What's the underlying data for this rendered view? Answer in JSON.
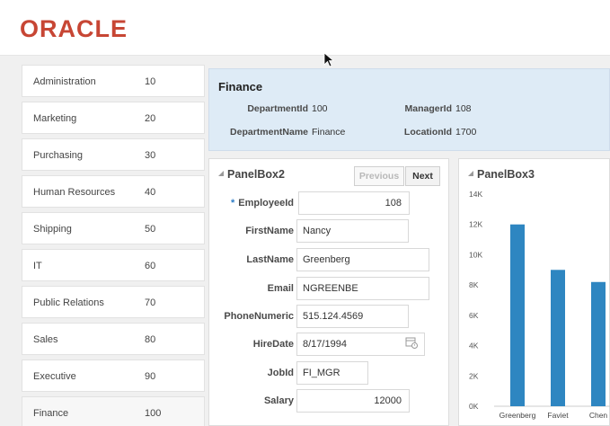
{
  "header": {
    "logo_text": "ORACLE",
    "brand_color": "#c74634"
  },
  "departments": [
    {
      "name": "Administration",
      "id": "10"
    },
    {
      "name": "Marketing",
      "id": "20"
    },
    {
      "name": "Purchasing",
      "id": "30"
    },
    {
      "name": "Human Resources",
      "id": "40"
    },
    {
      "name": "Shipping",
      "id": "50"
    },
    {
      "name": "IT",
      "id": "60"
    },
    {
      "name": "Public Relations",
      "id": "70"
    },
    {
      "name": "Sales",
      "id": "80"
    },
    {
      "name": "Executive",
      "id": "90"
    },
    {
      "name": "Finance",
      "id": "100"
    }
  ],
  "selected_department": "Finance",
  "finance_detail": {
    "title": "Finance",
    "department_id_label": "DepartmentId",
    "department_id": "100",
    "manager_id_label": "ManagerId",
    "manager_id": "108",
    "department_name_label": "DepartmentName",
    "department_name": "Finance",
    "location_id_label": "LocationId",
    "location_id": "1700"
  },
  "panel2": {
    "title": "PanelBox2",
    "previous_label": "Previous",
    "next_label": "Next",
    "fields": {
      "employee_id": {
        "label": "EmployeeId",
        "value": "108",
        "required": "*"
      },
      "first_name": {
        "label": "FirstName",
        "value": "Nancy"
      },
      "last_name": {
        "label": "LastName",
        "value": "Greenberg"
      },
      "email": {
        "label": "Email",
        "value": "NGREENBE"
      },
      "phone": {
        "label": "PhoneNumeric",
        "value": "515.124.4569"
      },
      "hire_date": {
        "label": "HireDate",
        "value": "8/17/1994"
      },
      "job_id": {
        "label": "JobId",
        "value": "FI_MGR"
      },
      "salary": {
        "label": "Salary",
        "value": "12000"
      }
    }
  },
  "panel3": {
    "title": "PanelBox3",
    "bar_color": "#2e86c1",
    "y_ticks": [
      "14K",
      "12K",
      "10K",
      "8K",
      "6K",
      "4K",
      "2K",
      "0K"
    ]
  },
  "chart_data": {
    "type": "bar",
    "categories": [
      "Greenberg",
      "Faviet",
      "Chen"
    ],
    "values": [
      12000,
      9000,
      8200
    ],
    "ylim": [
      0,
      14000
    ],
    "grid": false
  }
}
